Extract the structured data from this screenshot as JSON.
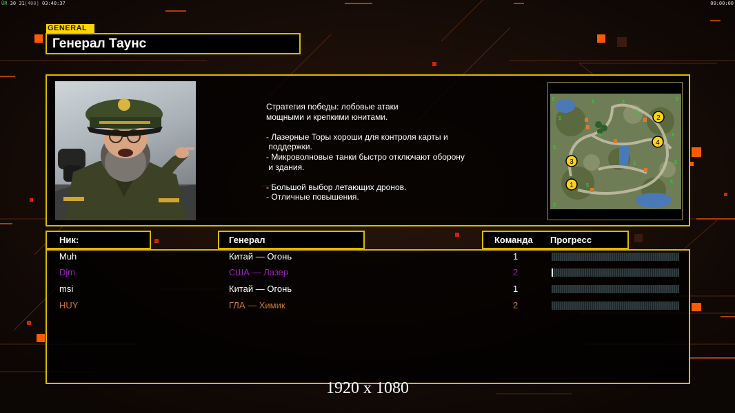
{
  "hud": {
    "fps_label": "ÜR",
    "fps_value": "30 31",
    "fps_cap": "[400]",
    "clock": "03:40:37",
    "timer": "00:00:00"
  },
  "general": {
    "tag": "GENERAL",
    "name": "Генерал Таунс",
    "description": "Стратегия победы: лобовые атаки\nмощными и крепкими юнитами.\n\n- Лазерные Торы хороши для контроля карты и\n поддержки.\n- Микроволновые танки быстро отключают оборону\n и здания.\n\n- Большой выбор летающих дронов.\n- Отличные повышения."
  },
  "map": {
    "start_positions": [
      "1",
      "2",
      "3",
      "4"
    ],
    "icons": [
      "supply-icon",
      "oil-derrick-icon",
      "water-icon"
    ]
  },
  "table": {
    "headers": {
      "nick": "Ник:",
      "general": "Генерал",
      "team": "Команда",
      "progress": "Прогресс"
    },
    "players": [
      {
        "nick": "Muh",
        "general": "Китай — Огонь",
        "team": "1",
        "progress": 0.0,
        "color": "#ffffff"
      },
      {
        "nick": "Djm",
        "general": "США — Лазер",
        "team": "2",
        "progress": 0.01,
        "color": "#a020c0"
      },
      {
        "nick": "msi",
        "general": "Китай — Огонь",
        "team": "1",
        "progress": 0.0,
        "color": "#ffffff"
      },
      {
        "nick": "HUY",
        "general": "ГЛА — Химик",
        "team": "2",
        "progress": 0.0,
        "color": "#c87a30"
      }
    ]
  },
  "colors": {
    "accent_gold": "#e0b800",
    "accent_orange": "#ff5a00",
    "panel_bg": "#000000"
  },
  "overlay": {
    "resolution_label": "1920 x 1080"
  }
}
